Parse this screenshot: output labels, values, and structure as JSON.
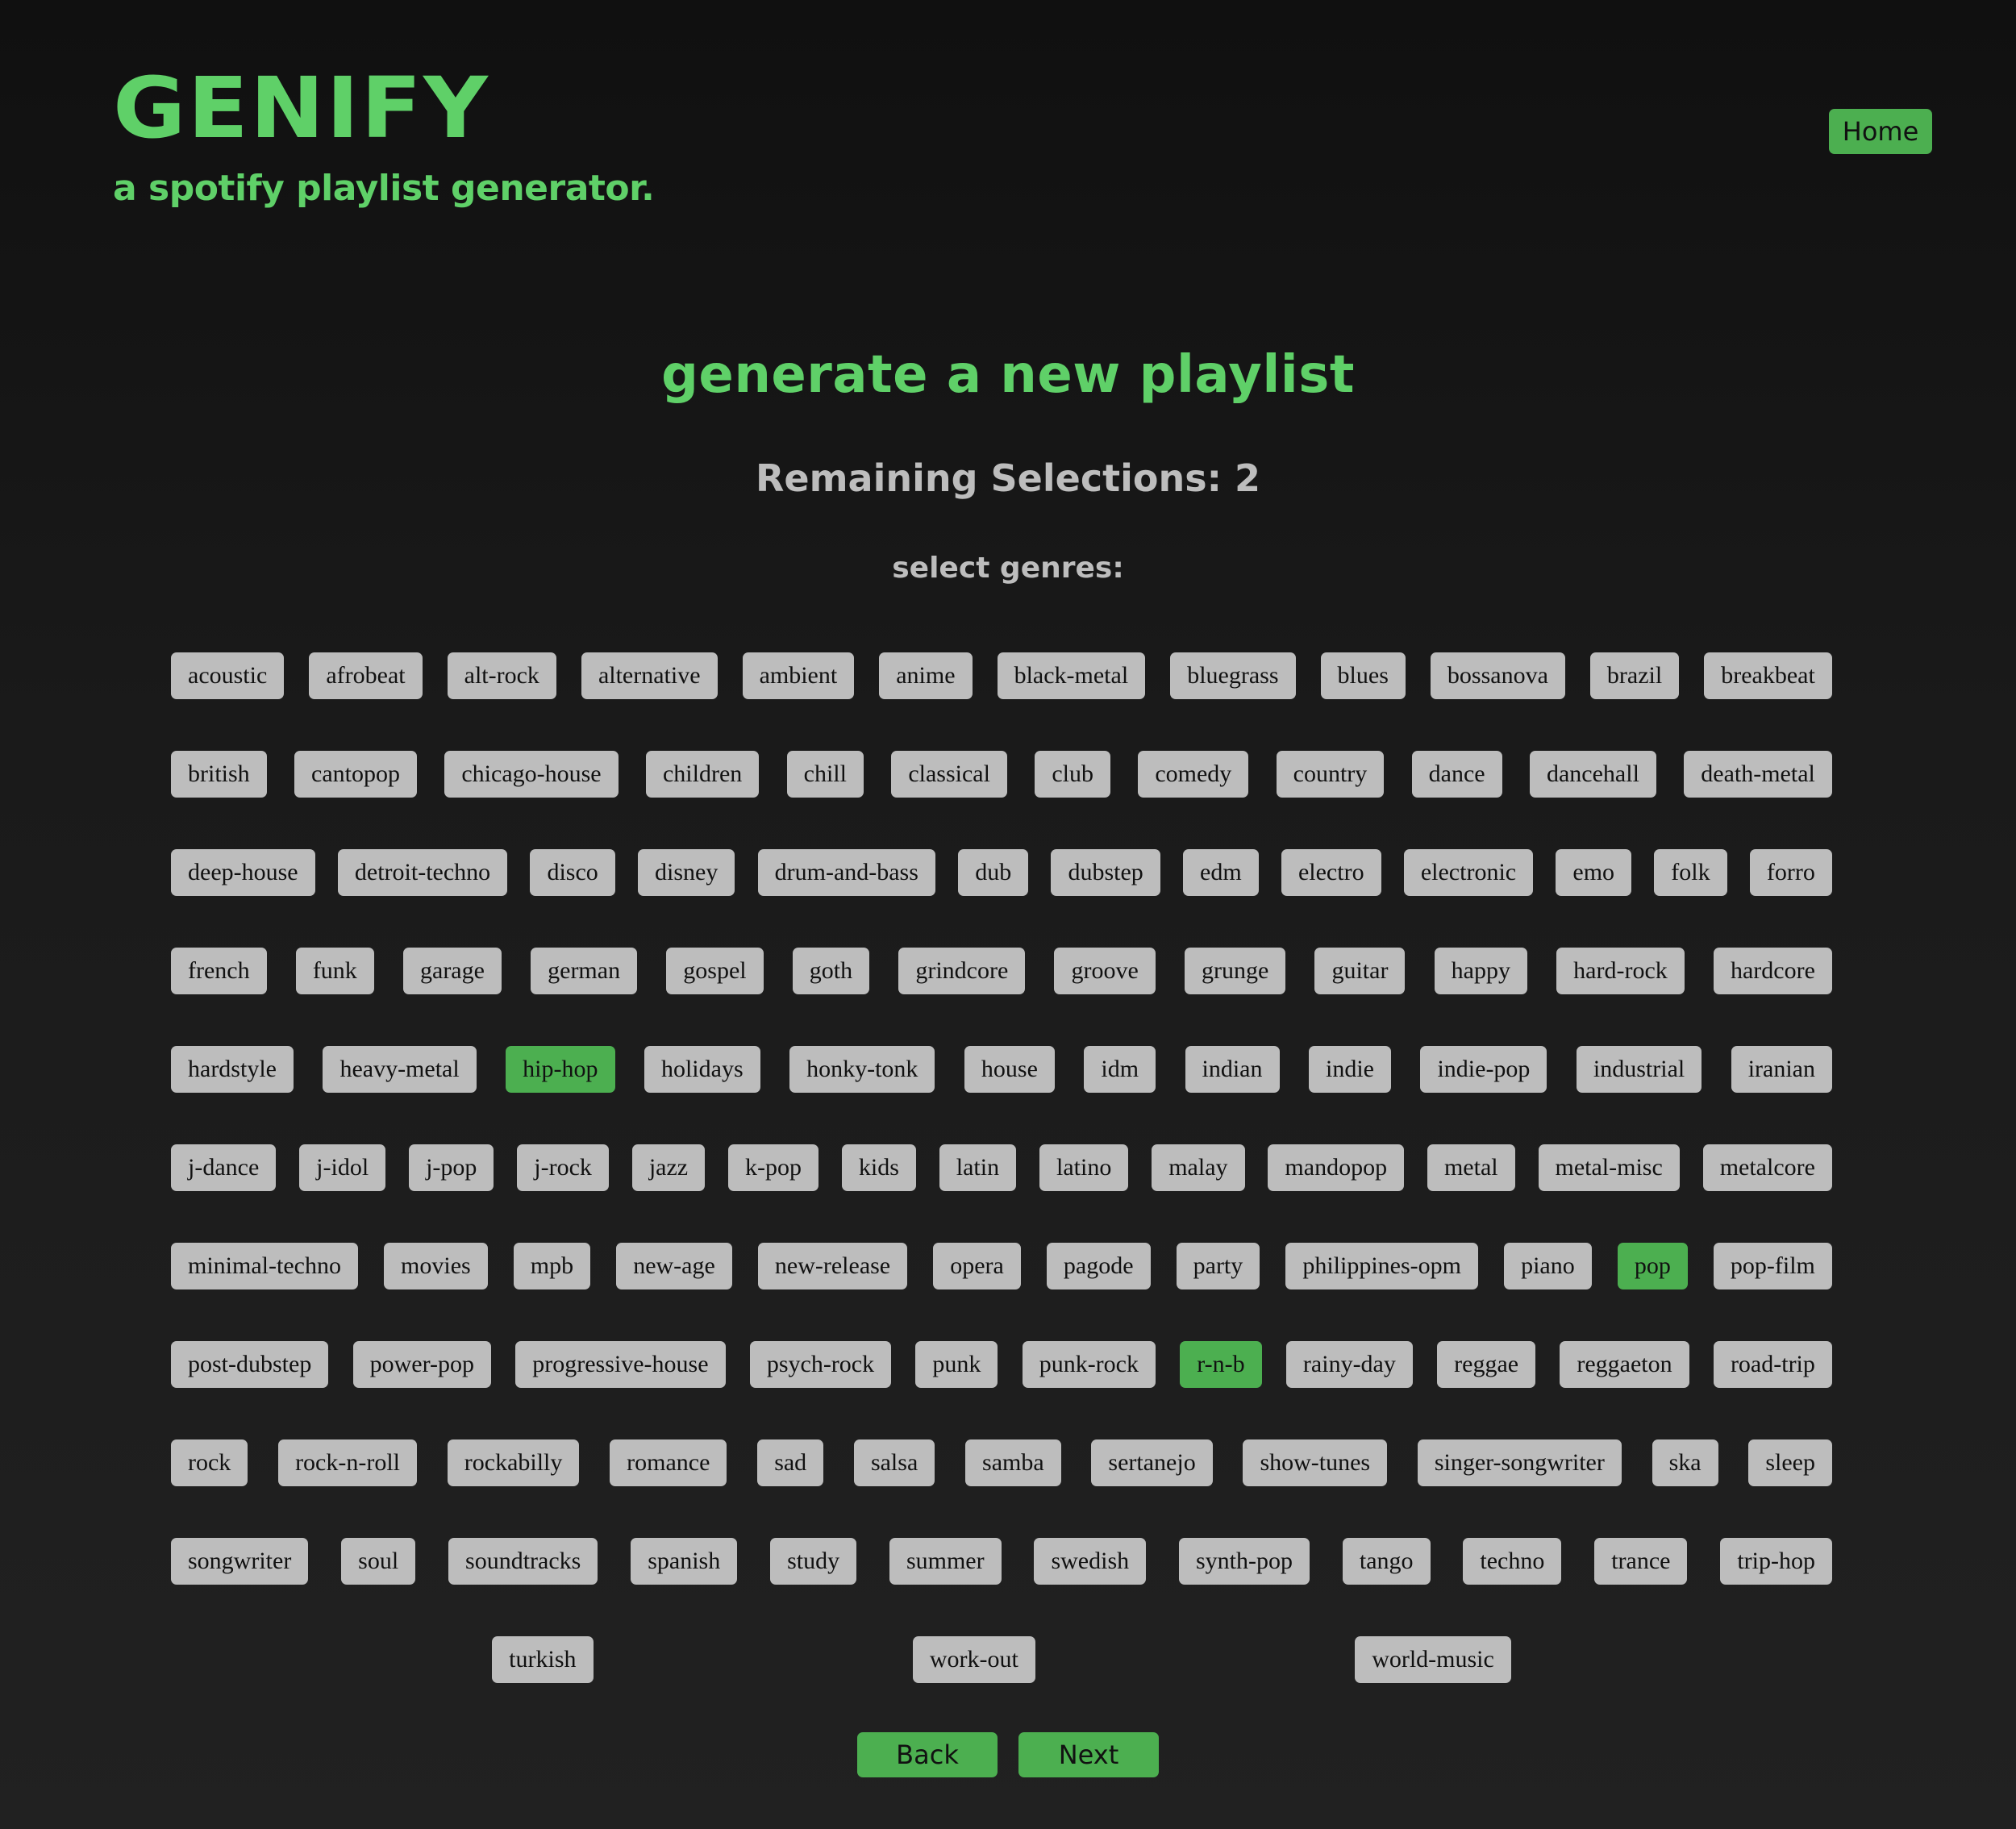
{
  "header": {
    "logo": "GENIFY",
    "tagline": "a spotify playlist generator.",
    "home_label": "Home"
  },
  "main": {
    "title": "generate a new playlist",
    "remaining_label": "Remaining Selections: 2",
    "select_label": "select genres:"
  },
  "genre_rows": [
    [
      "acoustic",
      "afrobeat",
      "alt-rock",
      "alternative",
      "ambient",
      "anime",
      "black-metal",
      "bluegrass",
      "blues",
      "bossanova",
      "brazil",
      "breakbeat"
    ],
    [
      "british",
      "cantopop",
      "chicago-house",
      "children",
      "chill",
      "classical",
      "club",
      "comedy",
      "country",
      "dance",
      "dancehall",
      "death-metal"
    ],
    [
      "deep-house",
      "detroit-techno",
      "disco",
      "disney",
      "drum-and-bass",
      "dub",
      "dubstep",
      "edm",
      "electro",
      "electronic",
      "emo",
      "folk",
      "forro"
    ],
    [
      "french",
      "funk",
      "garage",
      "german",
      "gospel",
      "goth",
      "grindcore",
      "groove",
      "grunge",
      "guitar",
      "happy",
      "hard-rock",
      "hardcore"
    ],
    [
      "hardstyle",
      "heavy-metal",
      "hip-hop",
      "holidays",
      "honky-tonk",
      "house",
      "idm",
      "indian",
      "indie",
      "indie-pop",
      "industrial",
      "iranian"
    ],
    [
      "j-dance",
      "j-idol",
      "j-pop",
      "j-rock",
      "jazz",
      "k-pop",
      "kids",
      "latin",
      "latino",
      "malay",
      "mandopop",
      "metal",
      "metal-misc",
      "metalcore"
    ],
    [
      "minimal-techno",
      "movies",
      "mpb",
      "new-age",
      "new-release",
      "opera",
      "pagode",
      "party",
      "philippines-opm",
      "piano",
      "pop",
      "pop-film"
    ],
    [
      "post-dubstep",
      "power-pop",
      "progressive-house",
      "psych-rock",
      "punk",
      "punk-rock",
      "r-n-b",
      "rainy-day",
      "reggae",
      "reggaeton",
      "road-trip"
    ],
    [
      "rock",
      "rock-n-roll",
      "rockabilly",
      "romance",
      "sad",
      "salsa",
      "samba",
      "sertanejo",
      "show-tunes",
      "singer-songwriter",
      "ska",
      "sleep"
    ],
    [
      "songwriter",
      "soul",
      "soundtracks",
      "spanish",
      "study",
      "summer",
      "swedish",
      "synth-pop",
      "tango",
      "techno",
      "trance",
      "trip-hop"
    ],
    [
      "turkish",
      "work-out",
      "world-music"
    ]
  ],
  "selected_genres": [
    "hip-hop",
    "pop",
    "r-n-b"
  ],
  "buttons": {
    "back": "Back",
    "next": "Next"
  },
  "colors": {
    "accent": "#5fd068",
    "button": "#4caf50",
    "chip": "#bdbdbd",
    "background": "#1a1a1a"
  }
}
